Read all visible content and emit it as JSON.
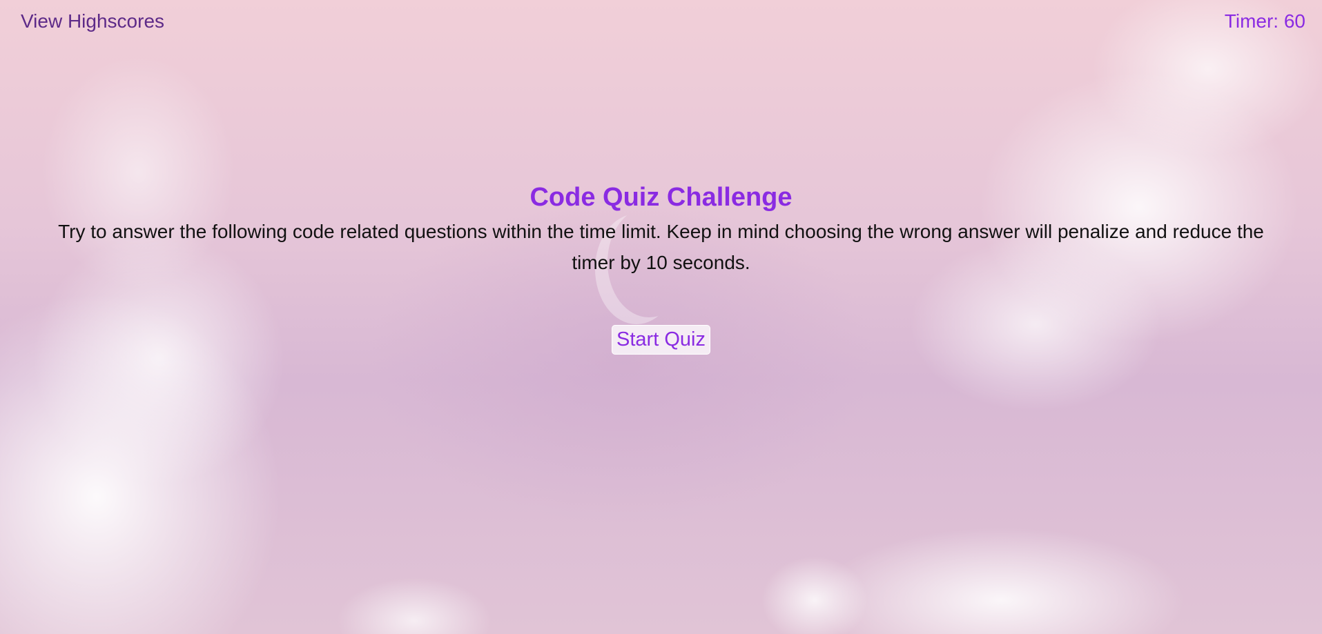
{
  "header": {
    "highscores_link": "View Highscores",
    "timer_text": "Timer: 60"
  },
  "main": {
    "title": "Code Quiz Challenge",
    "instructions": "Try to answer the following code related questions within the time limit. Keep in mind choosing the wrong answer will penalize and reduce the timer by 10 seconds.",
    "start_button_label": "Start Quiz"
  },
  "colors": {
    "accent": "#8a2be2",
    "link": "#5d2a88",
    "text": "#111111"
  }
}
